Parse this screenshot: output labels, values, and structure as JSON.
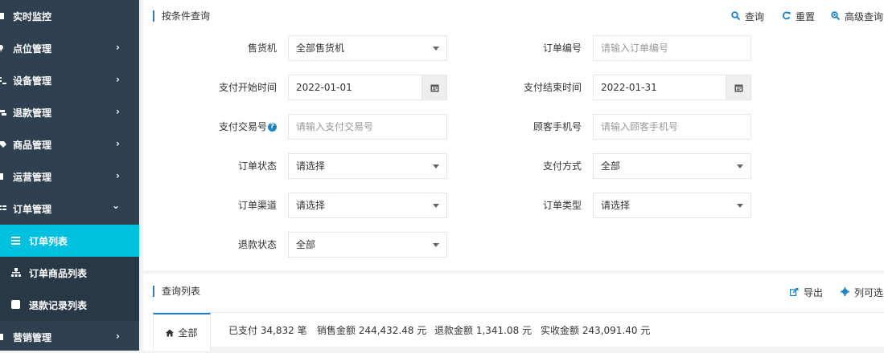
{
  "sidebar": {
    "items": [
      {
        "label": "实时监控",
        "icon": "monitor-icon",
        "chevron": ""
      },
      {
        "label": "点位管理",
        "icon": "map-marker-icon",
        "chevron": "›"
      },
      {
        "label": "设备管理",
        "icon": "list-icon",
        "chevron": "›"
      },
      {
        "label": "退款管理",
        "icon": "refund-icon",
        "chevron": "›"
      },
      {
        "label": "商品管理",
        "icon": "tag-icon",
        "chevron": "›"
      },
      {
        "label": "运营管理",
        "icon": "bar-icon",
        "chevron": "›"
      },
      {
        "label": "订单管理",
        "icon": "list-icon",
        "chevron": "⌄"
      }
    ],
    "subitems": [
      {
        "label": "订单列表",
        "icon": "bars-icon"
      },
      {
        "label": "订单商品列表",
        "icon": "sitemap-icon"
      },
      {
        "label": "退款记录列表",
        "icon": "square-icon"
      }
    ],
    "last": {
      "label": "营销管理",
      "chevron": "›"
    }
  },
  "query": {
    "title": "按条件查询",
    "search_label": "查询",
    "reset_label": "重置",
    "advanced_label": "高级查询"
  },
  "form": {
    "vending_label": "售货机",
    "vending_value": "全部售货机",
    "order_no_label": "订单编号",
    "order_no_placeholder": "请输入订单编号",
    "pay_start_label": "支付开始时间",
    "pay_start_value": "2022-01-01",
    "pay_end_label": "支付结束时间",
    "pay_end_value": "2022-01-31",
    "trade_no_label": "支付交易号",
    "trade_no_placeholder": "请输入支付交易号",
    "phone_label": "顾客手机号",
    "phone_placeholder": "请输入顾客手机号",
    "order_status_label": "订单状态",
    "order_status_value": "请选择",
    "pay_method_label": "支付方式",
    "pay_method_value": "全部",
    "channel_label": "订单渠道",
    "channel_value": "请选择",
    "order_type_label": "订单类型",
    "order_type_value": "请选择",
    "refund_status_label": "退款状态",
    "refund_status_value": "全部"
  },
  "list": {
    "title": "查询列表",
    "export_label": "导出",
    "columns_label": "列可选",
    "tab_all": "全部",
    "paid": "已支付 34,832 笔",
    "sales": "销售金额 244,432.48 元",
    "refund": "退款金额 1,341.08 元",
    "received": "实收金额 243,091.40 元"
  },
  "colors": {
    "sidebar_bg": "#2f4050",
    "active_bg": "#00c0e0",
    "accent": "#1c84c6"
  }
}
